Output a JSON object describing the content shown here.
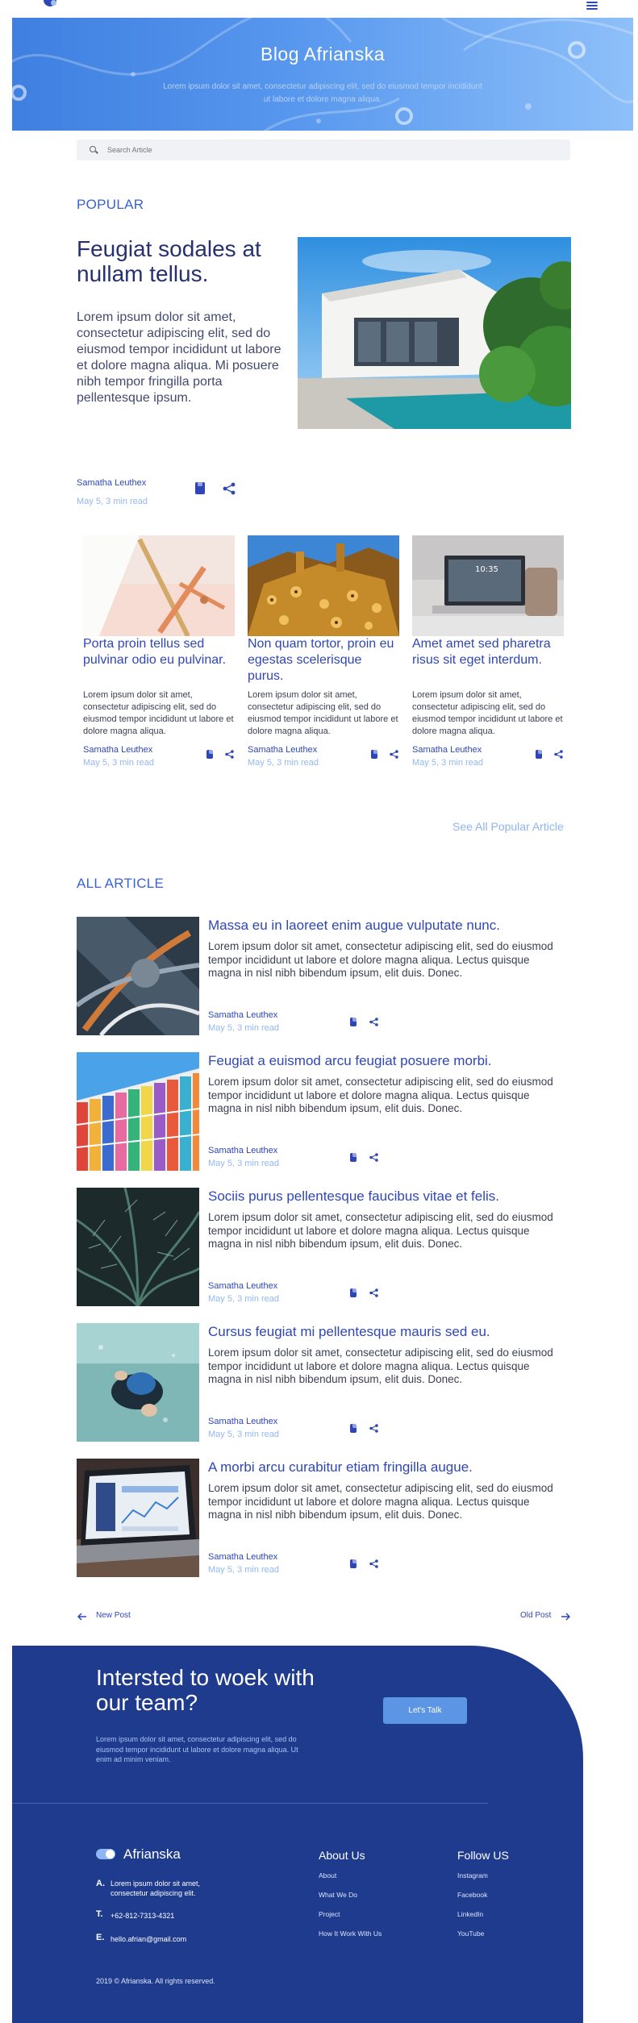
{
  "hero": {
    "title": "Blog Afrianska",
    "subtitle": "Lorem ipsum dolor sit amet, consectetur adipiscing elit, sed do eiusmod tempor incididunt ut labore et dolore magna aliqua."
  },
  "search": {
    "placeholder": "Search Article"
  },
  "popular": {
    "label": "POPULAR",
    "featured": {
      "title": "Feugiat sodales at nullam tellus.",
      "body": "Lorem ipsum dolor sit amet, consectetur adipiscing elit, sed do eiusmod tempor incididunt ut labore et dolore magna aliqua. Mi posuere nibh tempor fringilla porta pellentesque ipsum.",
      "author": "Samatha Leuthex",
      "date": "May 5, 3 min read"
    },
    "cards": [
      {
        "title": "Porta proin tellus sed pulvinar odio eu pulvinar.",
        "body": "Lorem ipsum dolor sit amet, consectetur adipiscing elit, sed do eiusmod tempor incididunt ut labore et dolore magna aliqua.",
        "author": "Samatha Leuthex",
        "date": "May 5, 3 min read"
      },
      {
        "title": "Non quam tortor, proin eu egestas scelerisque purus.",
        "body": "Lorem ipsum dolor sit amet, consectetur adipiscing elit, sed do eiusmod tempor incididunt ut labore et dolore magna aliqua.",
        "author": "Samatha Leuthex",
        "date": "May 5, 3 min read"
      },
      {
        "title": "Amet amet sed pharetra risus sit eget interdum.",
        "body": "Lorem ipsum dolor sit amet, consectetur adipiscing elit, sed do eiusmod tempor incididunt ut labore et dolore magna aliqua.",
        "author": "Samatha Leuthex",
        "date": "May 5, 3 min read"
      }
    ],
    "see_all": "See All Popular Article"
  },
  "all_articles": {
    "label": "ALL ARTICLE",
    "items": [
      {
        "title": "Massa eu in laoreet enim augue vulputate nunc.",
        "body": "Lorem ipsum dolor sit amet, consectetur adipiscing elit, sed do eiusmod tempor incididunt ut labore et dolore magna aliqua. Lectus quisque magna in nisl nibh bibendum ipsum, elit duis. Donec.",
        "author": "Samatha Leuthex",
        "date": "May 5, 3 min read"
      },
      {
        "title": "Feugiat a euismod arcu feugiat posuere morbi.",
        "body": "Lorem ipsum dolor sit amet, consectetur adipiscing elit, sed do eiusmod tempor incididunt ut labore et dolore magna aliqua. Lectus quisque magna in nisl nibh bibendum ipsum, elit duis. Donec.",
        "author": "Samatha Leuthex",
        "date": "May 5, 3 min read"
      },
      {
        "title": "Sociis purus pellentesque faucibus vitae et felis.",
        "body": "Lorem ipsum dolor sit amet, consectetur adipiscing elit, sed do eiusmod tempor incididunt ut labore et dolore magna aliqua. Lectus quisque magna in nisl nibh bibendum ipsum, elit duis. Donec.",
        "author": "Samatha Leuthex",
        "date": "May 5, 3 min read"
      },
      {
        "title": "Cursus feugiat mi pellentesque mauris sed eu.",
        "body": "Lorem ipsum dolor sit amet, consectetur adipiscing elit, sed do eiusmod tempor incididunt ut labore et dolore magna aliqua. Lectus quisque magna in nisl nibh bibendum ipsum, elit duis. Donec.",
        "author": "Samatha Leuthex",
        "date": "May 5, 3 min read"
      },
      {
        "title": "A morbi arcu curabitur etiam fringilla augue.",
        "body": "Lorem ipsum dolor sit amet, consectetur adipiscing elit, sed do eiusmod tempor incididunt ut labore et dolore magna aliqua. Lectus quisque magna in nisl nibh bibendum ipsum, elit duis. Donec.",
        "author": "Samatha Leuthex",
        "date": "May 5, 3 min read"
      }
    ]
  },
  "pagination": {
    "new": "New Post",
    "old": "Old Post"
  },
  "cta": {
    "title": "Intersted to woek with our team?",
    "subtitle": "Lorem ipsum dolor sit amet, consectetur adipiscing elit, sed do eiusmod tempor incididunt ut labore et dolore magna aliqua. Ut enim ad minim veniam.",
    "button": "Let's Talk"
  },
  "footer": {
    "brand": "Afrianska",
    "address_letter": "A.",
    "address": "Lorem ipsum dolor sit amet, consectetur adipiscing elit.",
    "phone_letter": "T.",
    "phone": "+62-812-7313-4321",
    "email_letter": "E.",
    "email": "hello.afrian@gmail.com",
    "about_heading": "About Us",
    "about_links": [
      "About",
      "What We Do",
      "Project",
      "How It Work With Us"
    ],
    "follow_heading": "Follow US",
    "follow_links": [
      "Instagram",
      "Facebook",
      "LinkedIn",
      "YouTube"
    ],
    "copyright": "2019 © Afrianska. All rights reserved."
  },
  "colors": {
    "primary": "#2f47b6",
    "accent": "#3a62d8",
    "footer": "#1f3b8e",
    "muted": "#93b8f0"
  }
}
